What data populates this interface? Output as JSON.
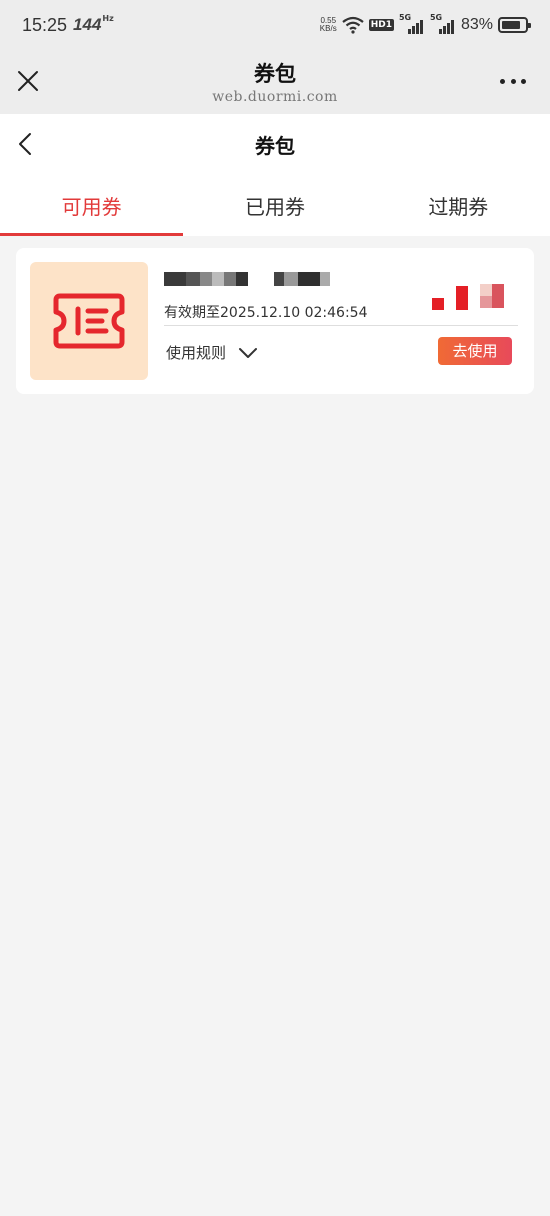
{
  "status_bar": {
    "time": "15:25",
    "refresh_rate": "144",
    "refresh_unit": "Hz",
    "net_speed_value": "0.55",
    "net_speed_unit": "KB/s",
    "hd_badge": "HD1",
    "sim1_label": "5G",
    "sim2_label": "5G",
    "battery_percent": "83%",
    "battery_level": 0.83
  },
  "webview": {
    "title": "券包",
    "url": "web.duormi.com",
    "close_icon": "close-icon",
    "more_icon": "more-icon"
  },
  "header": {
    "title": "券包",
    "back_icon": "chevron-left-icon"
  },
  "tabs": [
    {
      "label": "可用券",
      "active": true
    },
    {
      "label": "已用券",
      "active": false
    },
    {
      "label": "过期券",
      "active": false
    }
  ],
  "coupons": [
    {
      "thumbnail_icon": "ticket-icon",
      "expiry": "有效期至2025.12.10 02:46:54",
      "rules_label": "使用规则",
      "use_button": "去使用"
    }
  ],
  "colors": {
    "accent": "#e23a3a",
    "button_gradient_start": "#f06a35",
    "button_gradient_end": "#e84a5a",
    "thumb_bg": "#fde3c8",
    "page_bg": "#f4f4f4"
  }
}
